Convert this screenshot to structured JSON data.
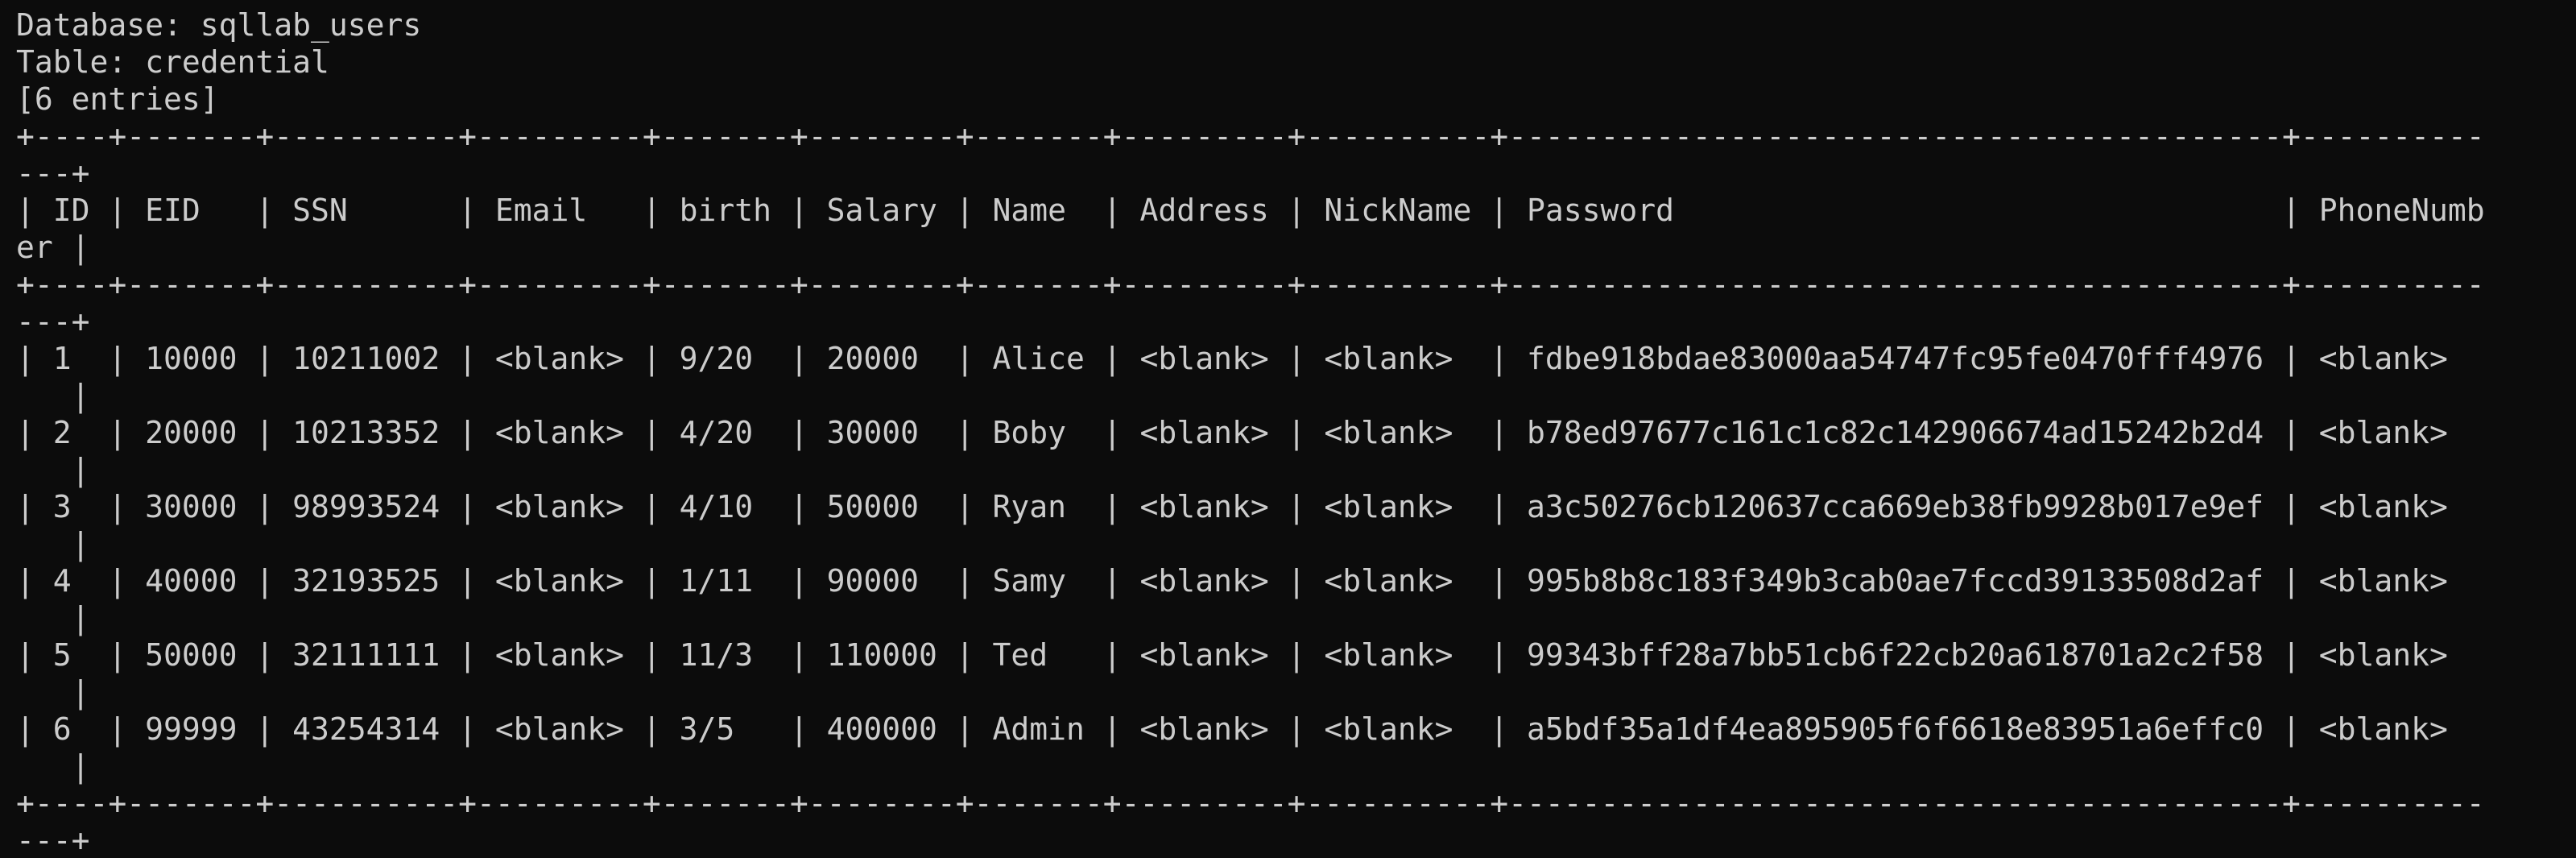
{
  "terminal": {
    "background": "#0c0c0c",
    "foreground": "#cccccc",
    "lines": [
      "Database: sqllab_users",
      "Table: credential",
      "[6 entries]",
      "+----+-------+----------+---------+-------+--------+-------+---------+----------+------------------------------------------+----------",
      "---+",
      "| ID | EID   | SSN      | Email   | birth | Salary | Name  | Address | NickName | Password                                 | PhoneNumb",
      "er |",
      "+----+-------+----------+---------+-------+--------+-------+---------+----------+------------------------------------------+----------",
      "---+",
      "| 1  | 10000 | 10211002 | <blank> | 9/20  | 20000  | Alice | <blank> | <blank>  | fdbe918bdae83000aa54747fc95fe0470fff4976 | <blank>",
      "   |",
      "| 2  | 20000 | 10213352 | <blank> | 4/20  | 30000  | Boby  | <blank> | <blank>  | b78ed97677c161c1c82c142906674ad15242b2d4 | <blank>",
      "   |",
      "| 3  | 30000 | 98993524 | <blank> | 4/10  | 50000  | Ryan  | <blank> | <blank>  | a3c50276cb120637cca669eb38fb9928b017e9ef | <blank>",
      "   |",
      "| 4  | 40000 | 32193525 | <blank> | 1/11  | 90000  | Samy  | <blank> | <blank>  | 995b8b8c183f349b3cab0ae7fccd39133508d2af | <blank>",
      "   |",
      "| 5  | 50000 | 32111111 | <blank> | 11/3  | 110000 | Ted   | <blank> | <blank>  | 99343bff28a7bb51cb6f22cb20a618701a2c2f58 | <blank>",
      "   |",
      "| 6  | 99999 | 43254314 | <blank> | 3/5   | 400000 | Admin | <blank> | <blank>  | a5bdf35a1df4ea895905f6f6618e83951a6effc0 | <blank>",
      "   |",
      "+----+-------+----------+---------+-------+--------+-------+---------+----------+------------------------------------------+----------",
      "---+"
    ]
  }
}
